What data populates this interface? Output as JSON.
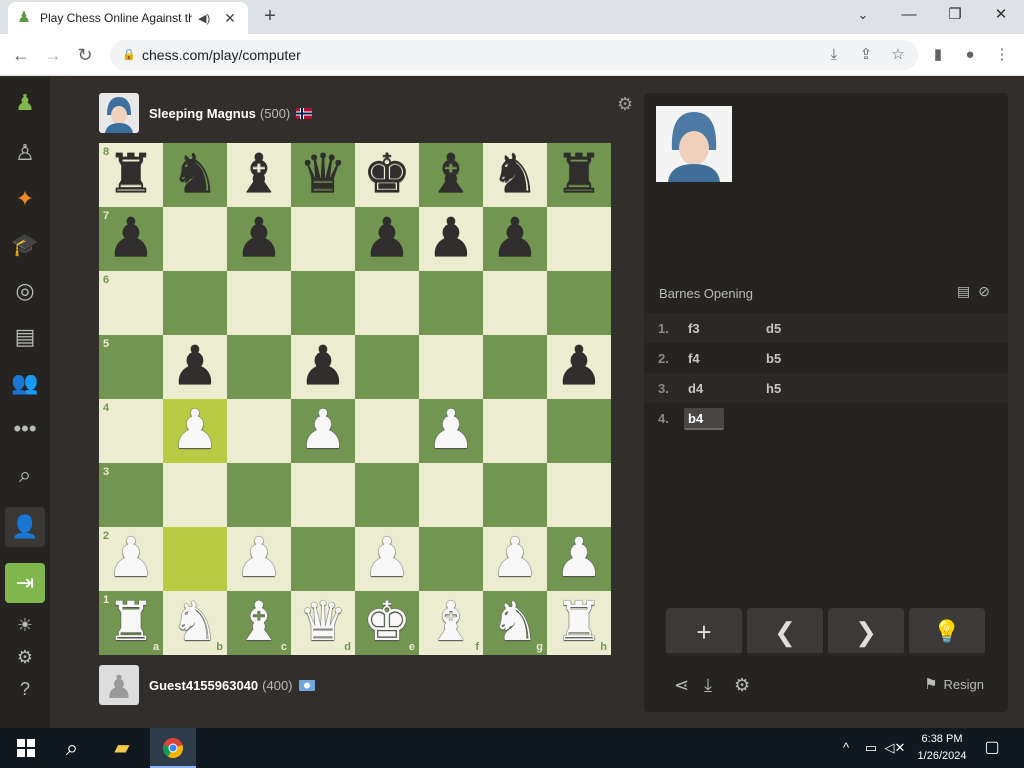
{
  "browser": {
    "tab_title": "Play Chess Online Against th",
    "url": "chess.com/play/computer"
  },
  "game": {
    "opponent": {
      "name": "Sleeping Magnus",
      "rating": "(500)"
    },
    "player": {
      "name": "Guest4155963040",
      "rating": "(400)"
    },
    "opening": "Barnes Opening",
    "moves": [
      {
        "no": "1.",
        "white": "f3",
        "black": "d5"
      },
      {
        "no": "2.",
        "white": "f4",
        "black": "b5"
      },
      {
        "no": "3.",
        "white": "d4",
        "black": "h5"
      },
      {
        "no": "4.",
        "white": "b4",
        "black": ""
      }
    ],
    "resign_label": "Resign"
  },
  "board": {
    "light_color": "#ebecd0",
    "dark_color": "#739552",
    "highlight_light": "#f5f682",
    "highlight_dark": "#b9ca43",
    "highlight_squares": [
      "b4",
      "b2"
    ],
    "ranks": [
      "8",
      "7",
      "6",
      "5",
      "4",
      "3",
      "2",
      "1"
    ],
    "files": [
      "a",
      "b",
      "c",
      "d",
      "e",
      "f",
      "g",
      "h"
    ],
    "position": [
      "rnbqkbnr",
      "p.p.ppp.",
      "........",
      ".p.p...p",
      ".P.P.P..",
      "........",
      "P.P.P.PP",
      "RNBQKBNR"
    ]
  },
  "taskbar": {
    "time": "6:38 PM",
    "date": "1/26/2024"
  }
}
